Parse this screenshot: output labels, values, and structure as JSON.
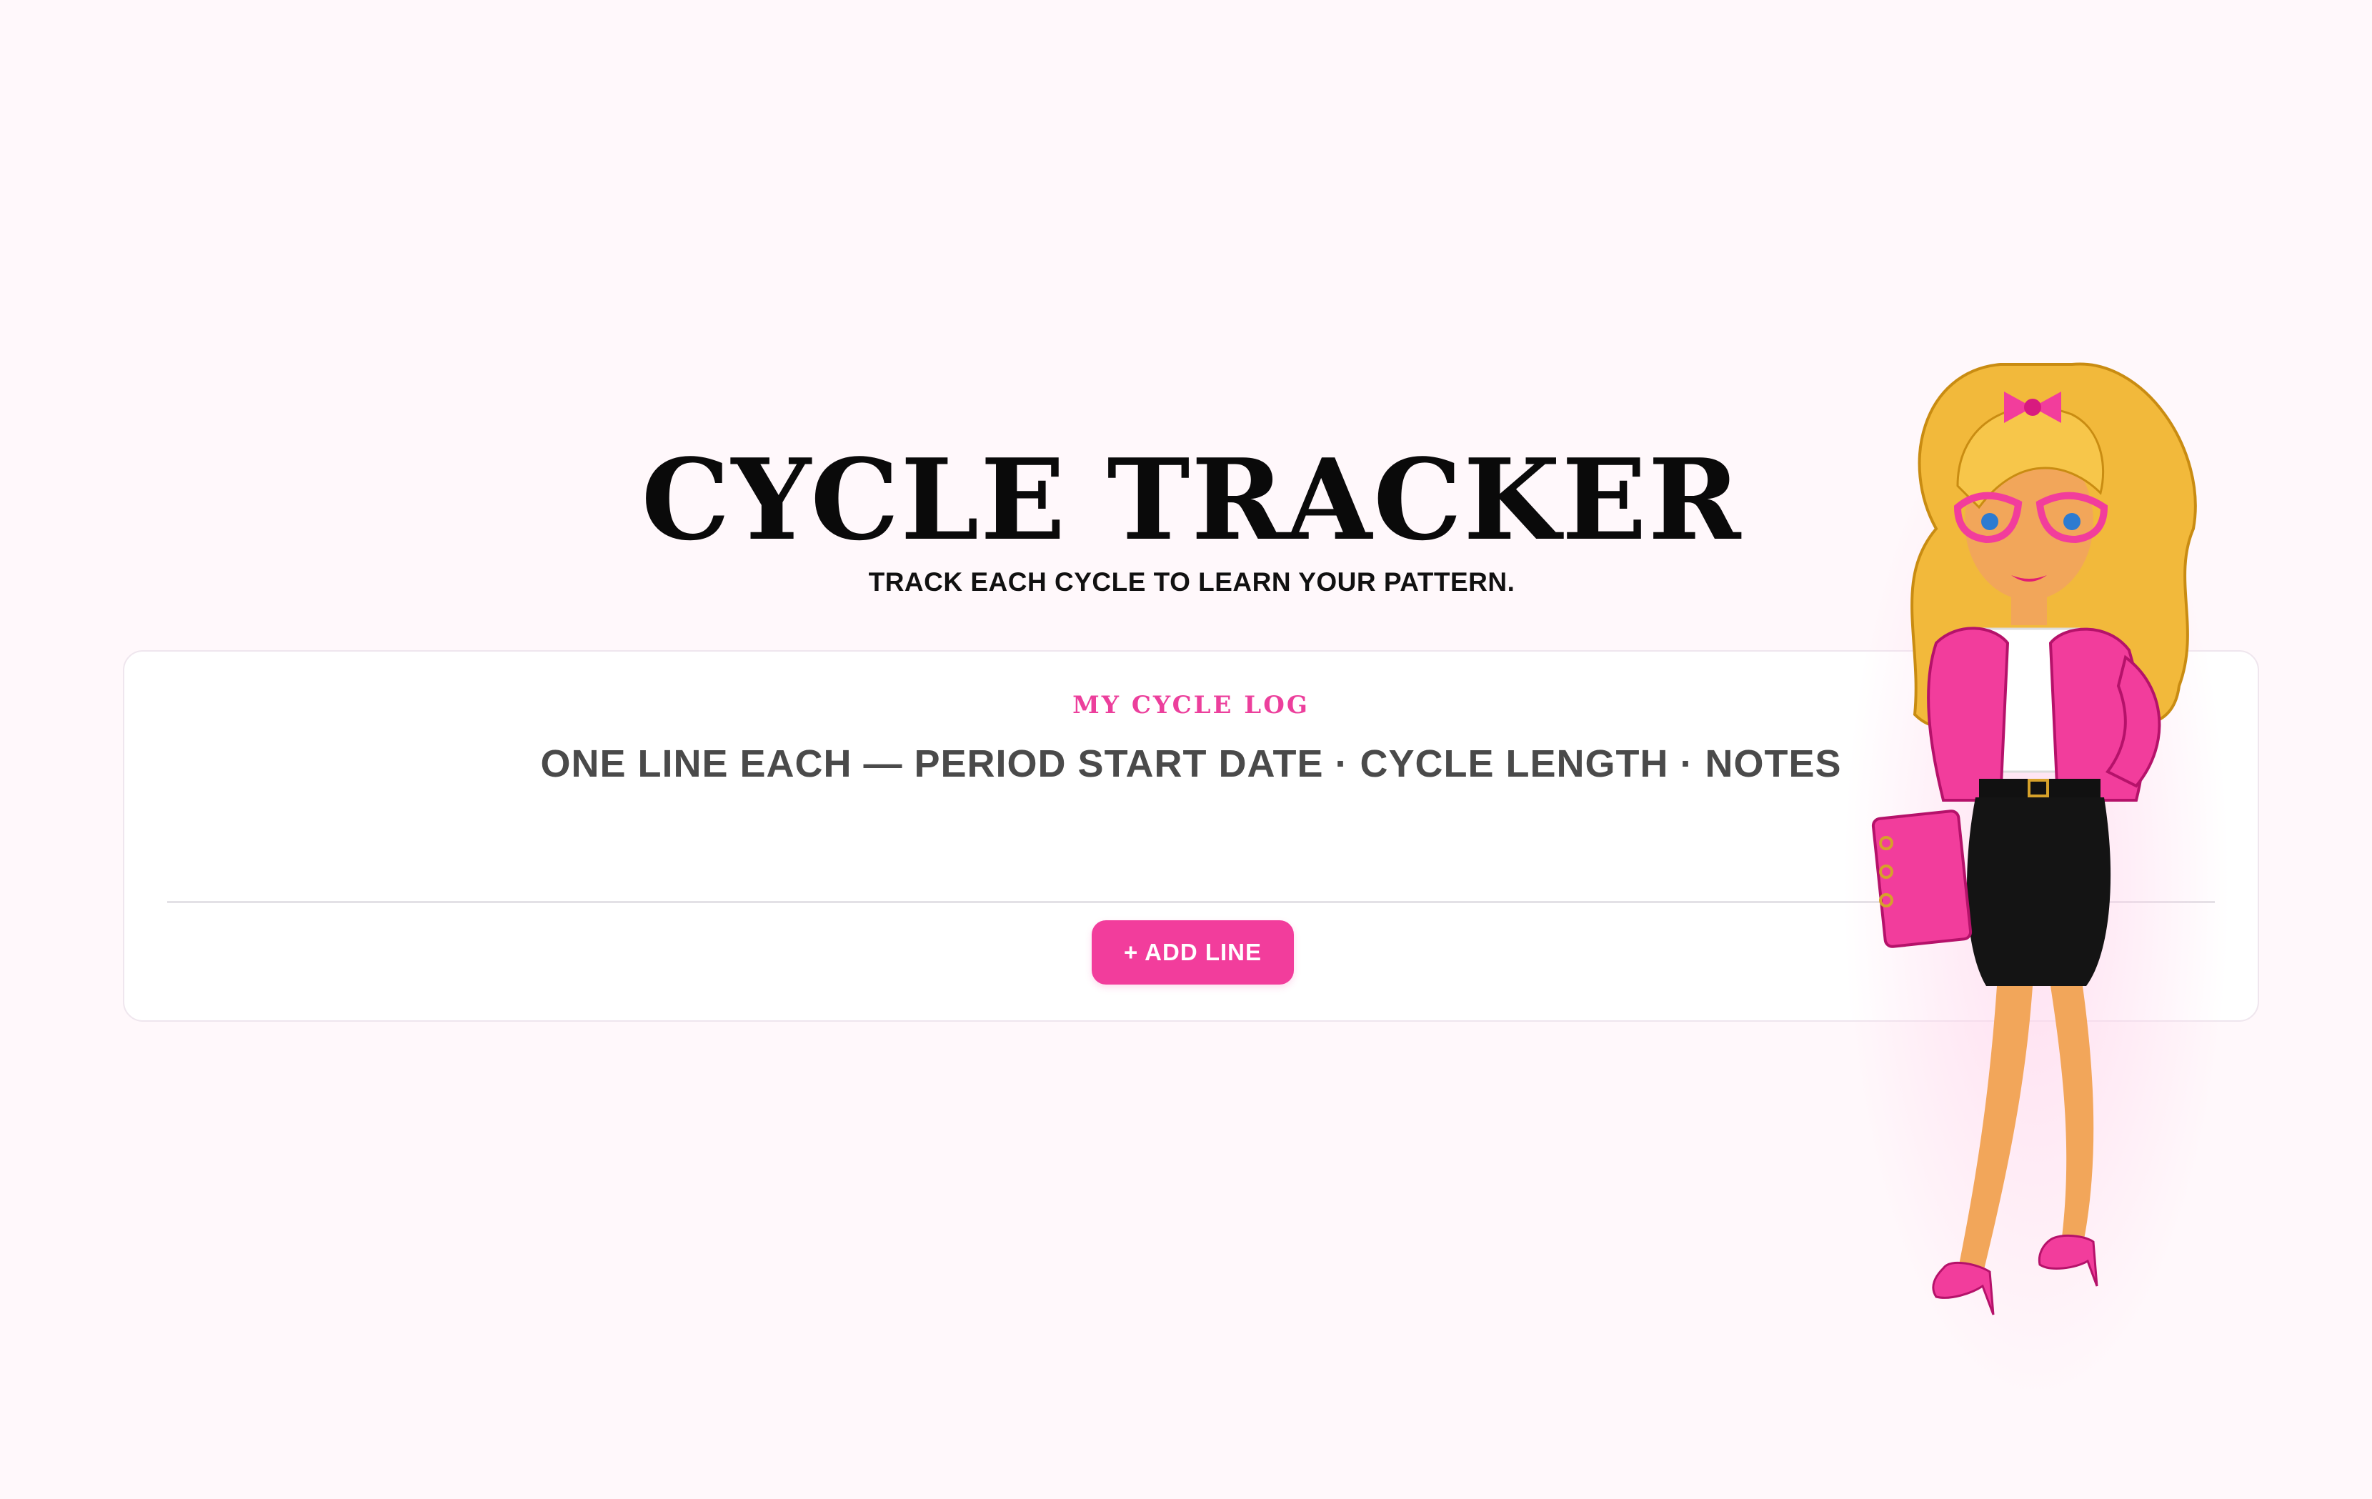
{
  "page": {
    "title": "CYCLE TRACKER",
    "subtitle": "TRACK EACH CYCLE TO LEARN YOUR PATTERN."
  },
  "log_card": {
    "label": "MY CYCLE LOG",
    "help_text": "ONE LINE EACH — PERIOD START DATE · CYCLE LENGTH · NOTES",
    "add_button_label": "+ ADD LINE"
  },
  "colors": {
    "background": "#fff8fb",
    "accent_pink": "#f23d9c",
    "label_pink": "#ec3f9c",
    "title": "#0a0a0a",
    "muted_text": "#4a4a4a"
  },
  "illustration": {
    "icon": "businesswoman-mascot-illustration"
  }
}
